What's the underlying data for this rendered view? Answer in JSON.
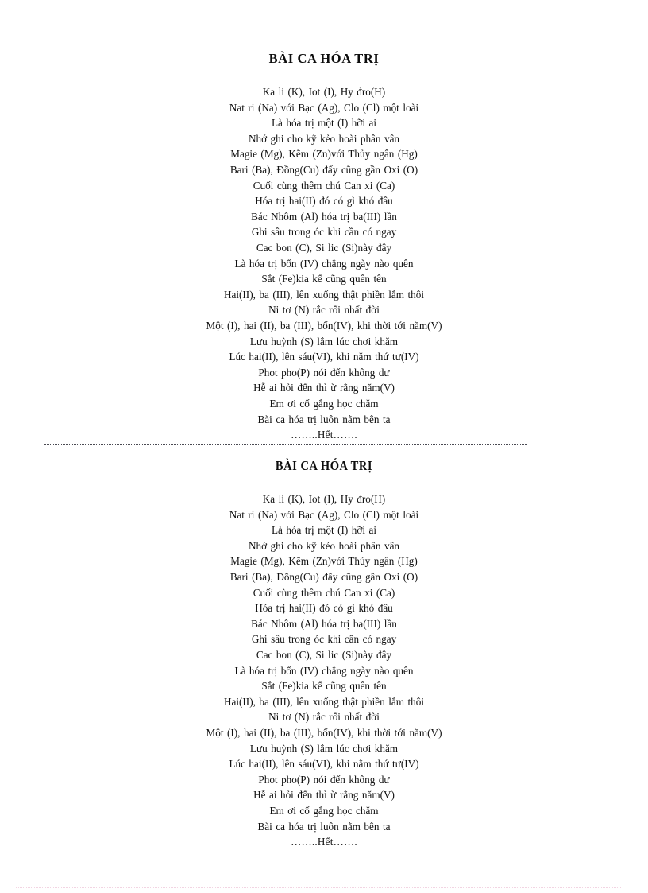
{
  "document": {
    "title": "BÀI CA HÓA TRỊ",
    "blocks": [
      {
        "id": "block-one",
        "title": "BÀI CA HÓA TRỊ",
        "lines": [
          "Ka li  (K), Iot (I), Hy đro(H)",
          "Nat ri (Na) với  Bạc  (Ag),  Clo  (Cl)  một loài",
          "Là hóa trị một  (I) hỡi  ai",
          "Nhớ ghi  cho kỹ kẻo hoài  phân  vân",
          "Magie  (Mg),  Kẽm  (Zn)với   Thủy ngân  (Hg)",
          "Bari  (Ba), Đồng(Cu)  đấy cũng  gần  Oxi  (O)",
          "Cuối cùng  thêm  chú  Can xi  (Ca)",
          "Hóa trị  hai(II)   đó có gì khó  đâu",
          "Bác  Nhôm  (Al)  hóa  trị  ba(III)  lần",
          "Ghi  sâu  trong  óc khi  cần có ngay",
          "Cac bon  (C), Si lic  (Si)này  đây",
          "Là hóa trị  bốn  (IV)  chẳng  ngày  nào  quên",
          "Sắt  (Fe)kia kể cũng  quên  tên",
          "Hai(II),  ba (III),  lên  xuống  thật phiền  lắm  thôi",
          "Ni tơ (N) rắc rối nhất  đời",
          "Một  (I), hai  (II),  ba  (III),  bốn(IV),  khi thời  tới năm(V)",
          "Lưu huỳnh   (S) lắm lúc  chơi  khăm",
          "Lúc  hai(II),  lên  sáu(VI),  khi  năm  thứ  tư(IV)",
          "Phot pho(P)  nói  đến không  dư",
          "Hễ ai hỏi  đến thì  ừ rằng  năm(V)",
          "Em  ơi  cố gắng  học  chăm",
          "Bài  ca hóa trị  luôn  nằm  bên ta",
          "……..Hết……."
        ]
      },
      {
        "id": "block-two",
        "title": "BÀI CA HÓA TRỊ",
        "lines": [
          "Ka li  (K), Iot (I), Hy đro(H)",
          "Nat ri (Na) với  Bạc  (Ag),  Clo  (Cl)  một loài",
          "Là hóa trị một  (I) hỡi  ai",
          "Nhớ ghi  cho kỹ kẻo hoài  phân  vân",
          "Magie  (Mg),  Kẽm  (Zn)với   Thủy ngân  (Hg)",
          "Bari  (Ba), Đồng(Cu)  đấy cũng  gần  Oxi  (O)",
          "Cuối cùng  thêm  chú  Can xi  (Ca)",
          "Hóa trị  hai(II)   đó có gì khó  đâu",
          "Bác  Nhôm  (Al)  hóa  trị  ba(III)  lần",
          "Ghi  sâu  trong  óc  khi  cần có ngay",
          "Cac bon  (C), Si lic  (Si)này  đây",
          "Là hóa trị  bốn  (IV)  chẳng  ngày  nào  quên",
          "Sắt  (Fe)kia kể cũng  quên  tên",
          "Hai(II),  ba  (III),  lên  xuống  thật phiền  lắm  thôi",
          "Ni tơ (N) rắc rối nhất  đời",
          "Một  (I), hai  (II),  ba  (III),  bốn(IV),  khi thời  tới năm(V)",
          "Lưu huỳnh   (S) lắm lúc  chơi  khăm",
          "Lúc  hai(II),  lên  sáu(VI),  khi  nằm  thứ  tư(IV)",
          "Phot pho(P)  nói  đến không  dư",
          "Hễ ai hỏi  đến thì  ừ rằng  năm(V)",
          "Em  ơi  cố  gắng  học  chăm",
          "Bài  ca hóa trị  luôn  nằm  bên ta",
          "……..Hết……."
        ]
      }
    ],
    "separators": {
      "middle_color": "#4a4a52",
      "footer_color": "#f2d4e2"
    }
  }
}
